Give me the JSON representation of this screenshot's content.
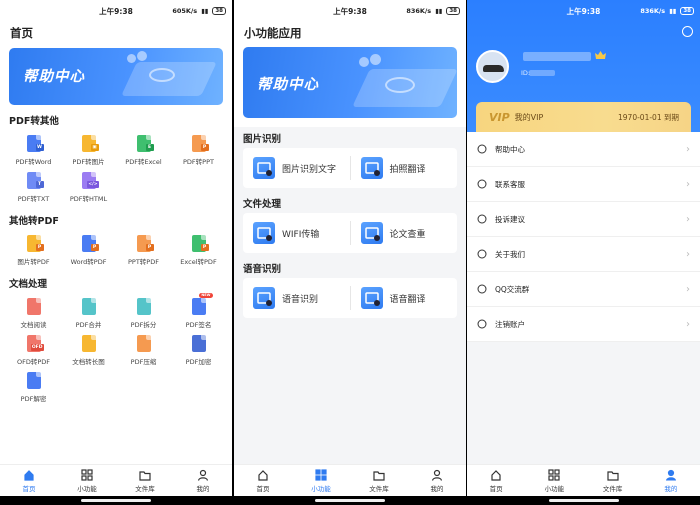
{
  "status": {
    "time": "上午9:38",
    "speed1": "605K/s",
    "speed2": "836K/s",
    "speed3": "836K/s",
    "battery": "38"
  },
  "home": {
    "title": "首页",
    "banner_text": "帮助中心",
    "sections": [
      {
        "title": "PDF转其他",
        "items": [
          {
            "label": "PDF转Word",
            "color": "#4a7cf3",
            "tag": "W",
            "tagcolor": "#2f5fd1"
          },
          {
            "label": "PDF转图片",
            "color": "#f7b731",
            "tag": "▣",
            "tagcolor": "#e89b0b"
          },
          {
            "label": "PDF转Excel",
            "color": "#3fbf6f",
            "tag": "E",
            "tagcolor": "#1f9d4f"
          },
          {
            "label": "PDF转PPT",
            "color": "#f59a50",
            "tag": "P",
            "tagcolor": "#e36f1e"
          },
          {
            "label": "PDF转TXT",
            "color": "#6f8bf5",
            "tag": "T",
            "tagcolor": "#4e68d6"
          },
          {
            "label": "PDF转HTML",
            "color": "#9b7cf2",
            "tag": "</>",
            "tagcolor": "#7b58dd"
          }
        ]
      },
      {
        "title": "其他转PDF",
        "items": [
          {
            "label": "图片转PDF",
            "color": "#f7b731",
            "tag": "P",
            "tagcolor": "#e36f1e"
          },
          {
            "label": "Word转PDF",
            "color": "#4a7cf3",
            "tag": "P",
            "tagcolor": "#e36f1e"
          },
          {
            "label": "PPT转PDF",
            "color": "#f59a50",
            "tag": "P",
            "tagcolor": "#e36f1e"
          },
          {
            "label": "Excel转PDF",
            "color": "#3fbf6f",
            "tag": "P",
            "tagcolor": "#e36f1e"
          }
        ]
      },
      {
        "title": "文档处理",
        "items": [
          {
            "label": "文档阅读",
            "color": "#f0766a",
            "tag": "",
            "tagcolor": "#e04b3c"
          },
          {
            "label": "PDF合并",
            "color": "#55c4c9",
            "tag": "",
            "tagcolor": "#2ba7ad"
          },
          {
            "label": "PDF拆分",
            "color": "#55c4c9",
            "tag": "",
            "tagcolor": "#2ba7ad"
          },
          {
            "label": "PDF签名",
            "color": "#4a7cf3",
            "tag": "",
            "tagcolor": "#2f5fd1",
            "badge": "NEW"
          },
          {
            "label": "OFD转PDF",
            "color": "#f0766a",
            "tag": "OFD",
            "tagcolor": "#e04b3c"
          },
          {
            "label": "文档转长图",
            "color": "#f7b731",
            "tag": "",
            "tagcolor": "#e89b0b"
          },
          {
            "label": "PDF压缩",
            "color": "#f59a50",
            "tag": "",
            "tagcolor": "#c2703a"
          },
          {
            "label": "PDF加密",
            "color": "#4a6fd6",
            "tag": "",
            "tagcolor": "#2f4fb0"
          },
          {
            "label": "PDF解密",
            "color": "#4a7cf3",
            "tag": "",
            "tagcolor": "#2f5fd1"
          }
        ]
      }
    ]
  },
  "tools": {
    "title": "小功能应用",
    "banner_text": "帮助中心",
    "sections": [
      {
        "title": "图片识别",
        "items": [
          {
            "label": "图片识别文字",
            "color": "#2f7bf0"
          },
          {
            "label": "拍照翻译",
            "color": "#2f7bf0"
          }
        ]
      },
      {
        "title": "文件处理",
        "items": [
          {
            "label": "WIFI传输",
            "color": "#2f7bf0"
          },
          {
            "label": "论文查重",
            "color": "#2f7bf0"
          }
        ]
      },
      {
        "title": "语音识别",
        "items": [
          {
            "label": "语音识别",
            "color": "#2f7bf0"
          },
          {
            "label": "语音翻译",
            "color": "#2f7bf0"
          }
        ]
      }
    ]
  },
  "profile": {
    "uid_label": "ID:",
    "vip_badge": "VIP",
    "vip_label": "我的VIP",
    "vip_date": "1970-01-01 到期",
    "menu": [
      {
        "label": "帮助中心",
        "icon": "help-icon"
      },
      {
        "label": "联系客服",
        "icon": "service-icon"
      },
      {
        "label": "投诉建议",
        "icon": "feedback-icon"
      },
      {
        "label": "关于我们",
        "icon": "about-icon"
      },
      {
        "label": "QQ交流群",
        "icon": "qq-icon"
      },
      {
        "label": "注销账户",
        "icon": "power-icon"
      }
    ]
  },
  "tabbar": [
    {
      "label": "首页",
      "icon": "home-icon"
    },
    {
      "label": "小功能",
      "icon": "grid-icon"
    },
    {
      "label": "文件库",
      "icon": "folder-icon"
    },
    {
      "label": "我的",
      "icon": "user-icon"
    }
  ],
  "colors": {
    "accent": "#2f7bf0",
    "vip_gold": "#f7d57f"
  }
}
